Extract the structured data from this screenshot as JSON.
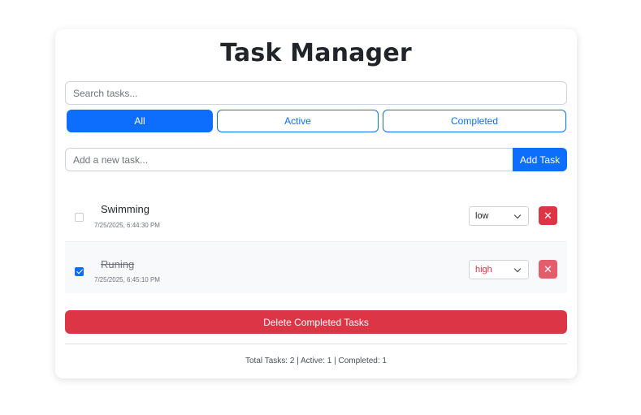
{
  "app": {
    "title": "Task Manager"
  },
  "search": {
    "placeholder": "Search tasks..."
  },
  "filters": [
    {
      "label": "All",
      "active": true
    },
    {
      "label": "Active",
      "active": false
    },
    {
      "label": "Completed",
      "active": false
    }
  ],
  "add_task": {
    "placeholder": "Add a new task...",
    "button_label": "Add Task"
  },
  "tasks": [
    {
      "text": "Swimming",
      "timestamp": "7/25/2025, 6:44:30 PM",
      "completed": false,
      "priority": "low",
      "priority_color": "#212529",
      "delete_label": "✕"
    },
    {
      "text": "Runing",
      "timestamp": "7/25/2025, 6:45:10 PM",
      "completed": true,
      "priority": "high",
      "priority_color": "#dc3545",
      "delete_label": "✕"
    }
  ],
  "actions": {
    "delete_completed_label": "Delete Completed Tasks"
  },
  "stats": {
    "text": "Total Tasks: 2 | Active: 1 | Completed: 1"
  },
  "colors": {
    "primary": "#0d6efd",
    "danger": "#dc3545"
  }
}
